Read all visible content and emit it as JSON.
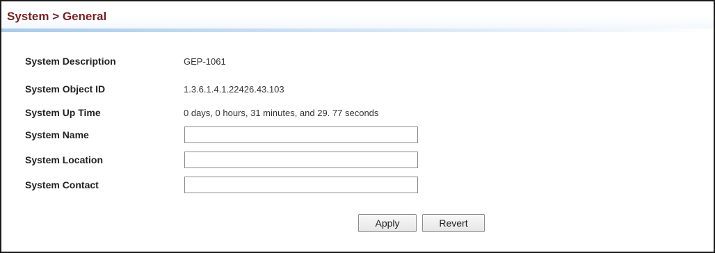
{
  "header": {
    "title": "System > General"
  },
  "fields": {
    "description": {
      "label": "System Description",
      "value": "GEP-1061"
    },
    "object_id": {
      "label": "System Object ID",
      "value": "1.3.6.1.4.1.22426.43.103"
    },
    "up_time": {
      "label": "System Up Time",
      "value": "0 days, 0 hours, 31 minutes, and 29. 77 seconds"
    },
    "name": {
      "label": "System Name",
      "value": ""
    },
    "location": {
      "label": "System Location",
      "value": ""
    },
    "contact": {
      "label": "System Contact",
      "value": ""
    }
  },
  "buttons": {
    "apply_label": "Apply",
    "revert_label": "Revert"
  },
  "colors": {
    "title": "#7a1e1e",
    "header_rule": "#a9cbe9"
  }
}
